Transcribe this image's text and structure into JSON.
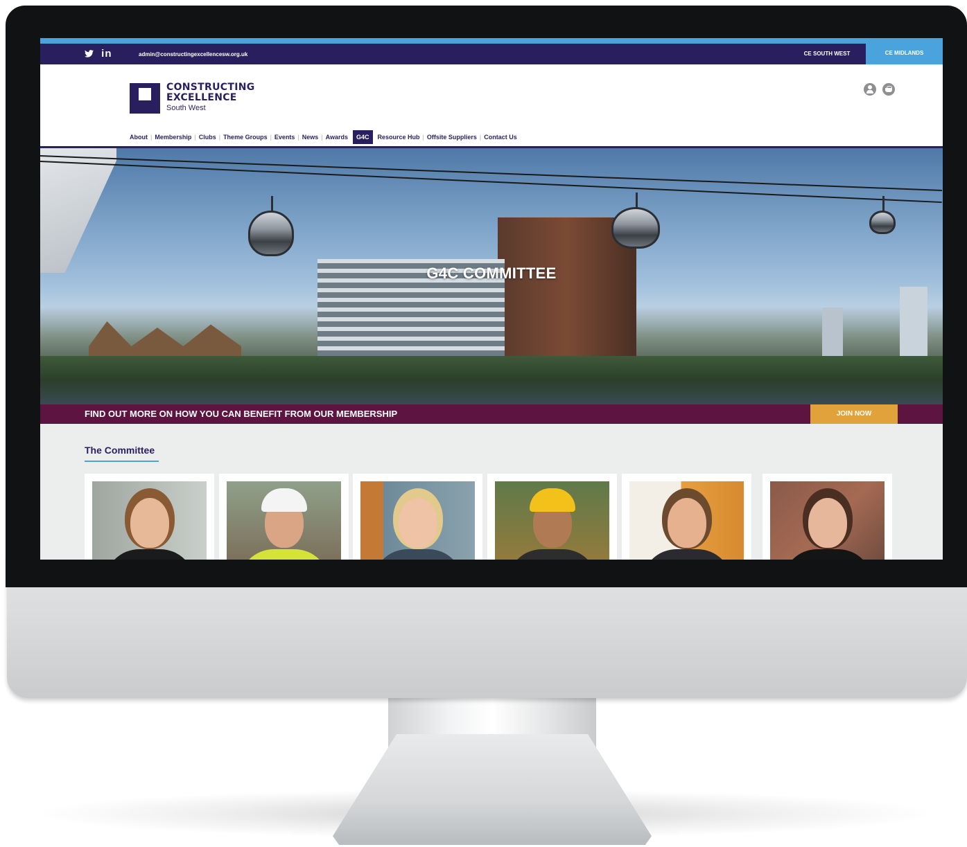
{
  "topbar": {
    "social": [
      "twitter",
      "in"
    ],
    "email": "admin@constructingexcellencesw.org.uk",
    "regions": [
      "CE SOUTH WEST",
      "CE MIDLANDS"
    ]
  },
  "logo": {
    "line1": "CONSTRUCTING",
    "line2": "EXCELLENCE",
    "line3": "South West"
  },
  "header_icons": [
    "user-icon",
    "cart-icon"
  ],
  "nav": {
    "items": [
      {
        "label": "About"
      },
      {
        "label": "Membership"
      },
      {
        "label": "Clubs"
      },
      {
        "label": "Theme Groups"
      },
      {
        "label": "Events"
      },
      {
        "label": "News"
      },
      {
        "label": "Awards"
      },
      {
        "label": "G4C"
      },
      {
        "label": "Resource Hub"
      },
      {
        "label": "Offsite Suppliers"
      },
      {
        "label": "Contact Us"
      }
    ],
    "active": "G4C"
  },
  "hero": {
    "title": "G4C COMMITTEE"
  },
  "membership_band": {
    "text": "FIND OUT MORE ON HOW YOU CAN BENEFIT FROM OUR MEMBERSHIP",
    "button": "JOIN NOW"
  },
  "committee": {
    "title": "The Committee",
    "members": 6
  },
  "colors": {
    "brand_navy": "#2a1f5e",
    "accent_blue": "#4ba3dd",
    "band_maroon": "#5e1440",
    "join_gold": "#e1a23c"
  }
}
